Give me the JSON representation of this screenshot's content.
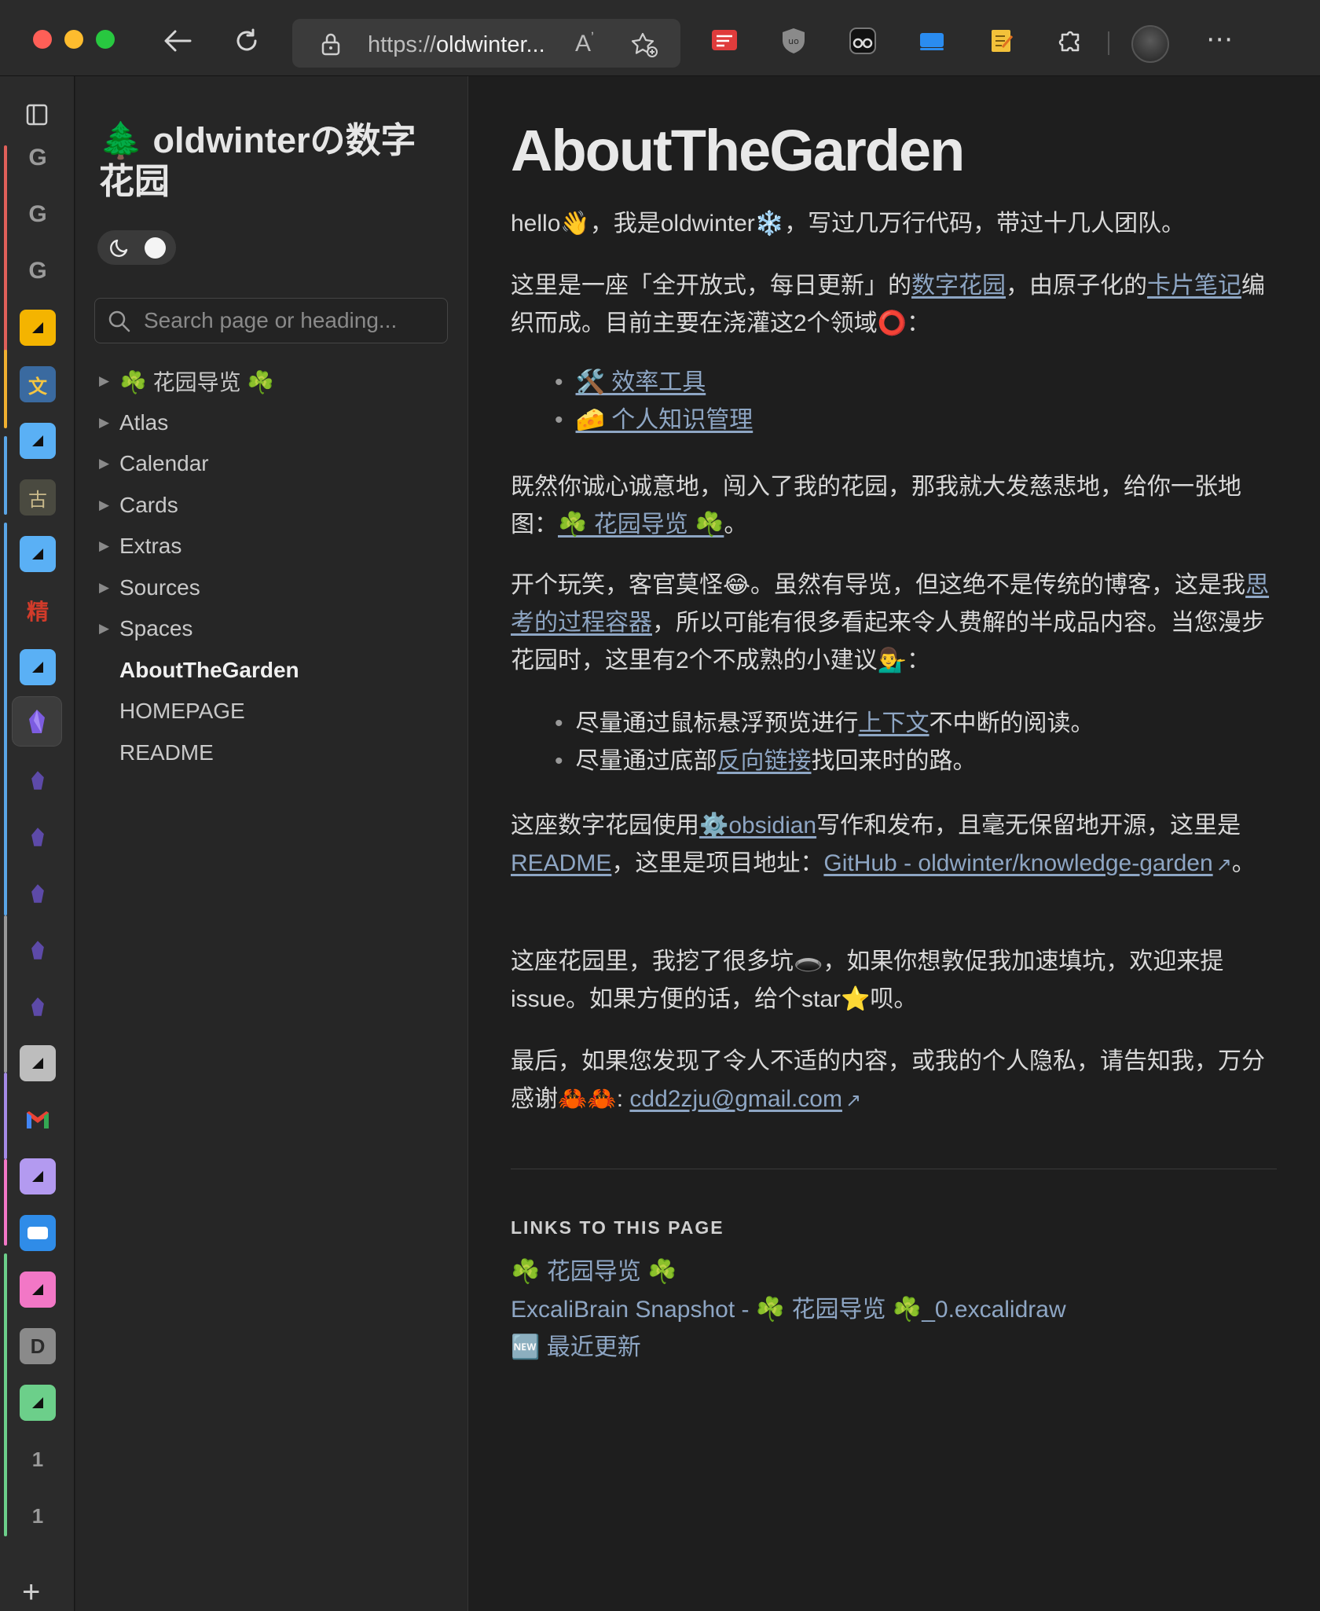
{
  "browser": {
    "url_prefix": "https://",
    "url_host": "oldwinter...",
    "read_aloud": "A̓",
    "more": "⋯"
  },
  "rail": {
    "new_tab": "+",
    "tab_glyphs": [
      "G",
      "G",
      "G",
      "古",
      "精",
      "1",
      "1"
    ]
  },
  "sidebar": {
    "site_title": "🌲 oldwinterの数字花园",
    "search_placeholder": "Search page or heading...",
    "tree": [
      {
        "label": "☘️ 花园导览 ☘️",
        "folder": true
      },
      {
        "label": "Atlas",
        "folder": true
      },
      {
        "label": "Calendar",
        "folder": true
      },
      {
        "label": "Cards",
        "folder": true
      },
      {
        "label": "Extras",
        "folder": true
      },
      {
        "label": "Sources",
        "folder": true
      },
      {
        "label": "Spaces",
        "folder": true
      },
      {
        "label": "AboutTheGarden",
        "folder": false,
        "current": true
      },
      {
        "label": "HOMEPAGE",
        "folder": false
      },
      {
        "label": "README",
        "folder": false
      }
    ]
  },
  "main": {
    "title": "AboutTheGarden",
    "p1": "hello👋，我是oldwinter❄️，写过几万行代码，带过十几人团队。",
    "p2": {
      "a": "这里是一座「全开放式，每日更新」的",
      "link1": "数字花园",
      "b": "，由原子化的",
      "link2": "卡片笔记",
      "c": "编织而成。目前主要在浇灌这2个领域⭕："
    },
    "domains": [
      "🛠️ 效率工具",
      "🧀 个人知识管理"
    ],
    "p3": {
      "a": "既然你诚心诚意地，闯入了我的花园，那我就大发慈悲地，给你一张地图：",
      "link": "☘️ 花园导览 ☘️",
      "b": "。"
    },
    "p4": {
      "a": "开个玩笑，客官莫怪😂。虽然有导览，但这绝不是传统的博客，这是我",
      "link": "思考的过程容器",
      "b": "，所以可能有很多看起来令人费解的半成品内容。当您漫步花园时，这里有2个不成熟的小建议💁‍♂️："
    },
    "tips": [
      {
        "a": "尽量通过鼠标悬浮预览进行",
        "link": "上下文",
        "b": "不中断的阅读。"
      },
      {
        "a": "尽量通过底部",
        "link": "反向链接",
        "b": "找回来时的路。"
      }
    ],
    "p5": {
      "a": "这座数字花园使用",
      "link1": "⚙️obsidian",
      "b": "写作和发布，且毫无保留地开源，这里是",
      "link2": "README",
      "c": "，这里是项目地址：",
      "link3": "GitHub - oldwinter/knowledge-garden",
      "d": "。"
    },
    "p6": "这座花园里，我挖了很多坑🕳️，如果你想敦促我加速填坑，欢迎来提issue。如果方便的话，给个star⭐呗。",
    "p7": {
      "a": "最后，如果您发现了令人不适的内容，或我的个人隐私，请告知我，万分感谢🦀🦀: ",
      "email": "cdd2zju@gmail.com"
    },
    "backlinks_heading": "LINKS TO THIS PAGE",
    "backlinks": [
      "☘️ 花园导览 ☘️",
      "ExcaliBrain Snapshot - ☘️ 花园导览 ☘️_0.excalidraw",
      "🆕 最近更新"
    ]
  }
}
